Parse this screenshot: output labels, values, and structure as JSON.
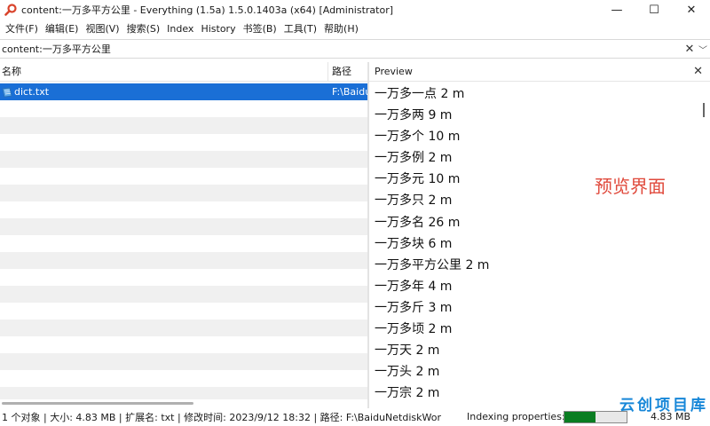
{
  "window": {
    "title": "content:一万多平方公里 - Everything (1.5a) 1.5.0.1403a (x64) [Administrator]",
    "minimize_glyph": "—",
    "maximize_glyph": "☐",
    "close_glyph": "✕"
  },
  "menu": [
    "文件(F)",
    "编辑(E)",
    "视图(V)",
    "搜索(S)",
    "Index",
    "History",
    "书签(B)",
    "工具(T)",
    "帮助(H)"
  ],
  "search": {
    "value": "content:一万多平方公里",
    "clear_glyph": "✕",
    "dropdown_glyph": "﹀"
  },
  "columns": {
    "name": "名称",
    "path": "路径"
  },
  "results": [
    {
      "name": "dict.txt",
      "path": "F:\\BaiduNetdiskWor",
      "selected": true
    }
  ],
  "preview": {
    "header": "Preview",
    "close_glyph": "✕",
    "lines": [
      "一万多一点 2 m",
      "一万多两 9 m",
      "一万多个 10 m",
      "一万多例 2 m",
      "一万多元 10 m",
      "一万多只 2 m",
      "一万多名 26 m",
      "一万多块 6 m",
      "一万多平方公里 2 m",
      "一万多年 4 m",
      "一万多斤 3 m",
      "一万多顷 2 m",
      "一万天 2 m",
      "一万头 2 m",
      "一万宗 2 m"
    ],
    "annotation": "预览界面"
  },
  "status": {
    "summary": "1 个对象  |  大小: 4.83 MB  |  扩展名: txt  |  修改时间: 2023/9/12 18:32  |  路径: F:\\BaiduNetdiskWor",
    "indexing_label": "Indexing properties:",
    "indexing_progress": 0.5,
    "size": "4.83 MB"
  },
  "watermark": "云创项目库",
  "colors": {
    "selection": "#1a6fd6",
    "progress": "#0a7d22",
    "annotation": "#e04a3c",
    "watermark": "#1787d8",
    "app_icon": "#d9442c"
  }
}
